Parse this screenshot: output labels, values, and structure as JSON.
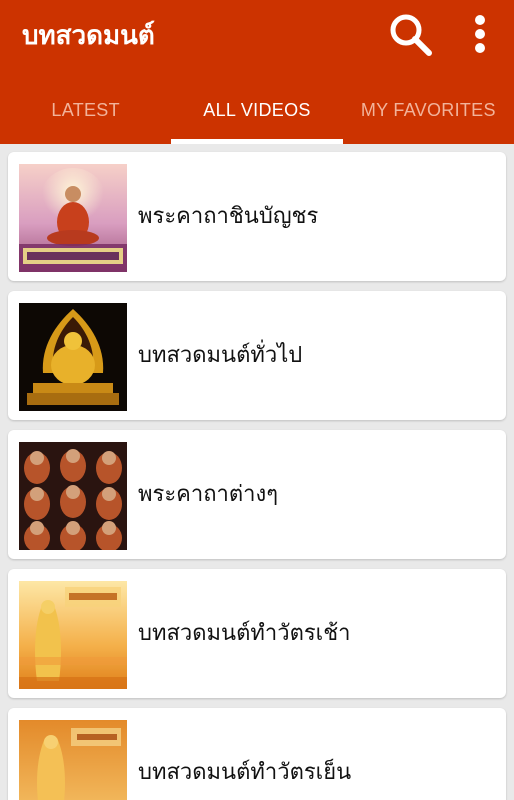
{
  "app": {
    "title": "บทสวดมนต์"
  },
  "toolbar": {
    "search_icon": "search-icon",
    "more_icon": "more-vert-icon"
  },
  "colors": {
    "appbar": "#cc3300",
    "tab_inactive": "#f2b39a",
    "tab_active": "#ffffff"
  },
  "tabs": [
    {
      "label": "LATEST",
      "active": false
    },
    {
      "label": "ALL VIDEOS",
      "active": true
    },
    {
      "label": "MY FAVORITES",
      "active": false
    }
  ],
  "videos": [
    {
      "title": "พระคาถาชินบัญชร"
    },
    {
      "title": "บทสวดมนต์ทั่วไป"
    },
    {
      "title": "พระคาถาต่างๆ"
    },
    {
      "title": "บทสวดมนต์ทำวัตรเช้า"
    },
    {
      "title": "บทสวดมนต์ทำวัตรเย็น"
    }
  ]
}
